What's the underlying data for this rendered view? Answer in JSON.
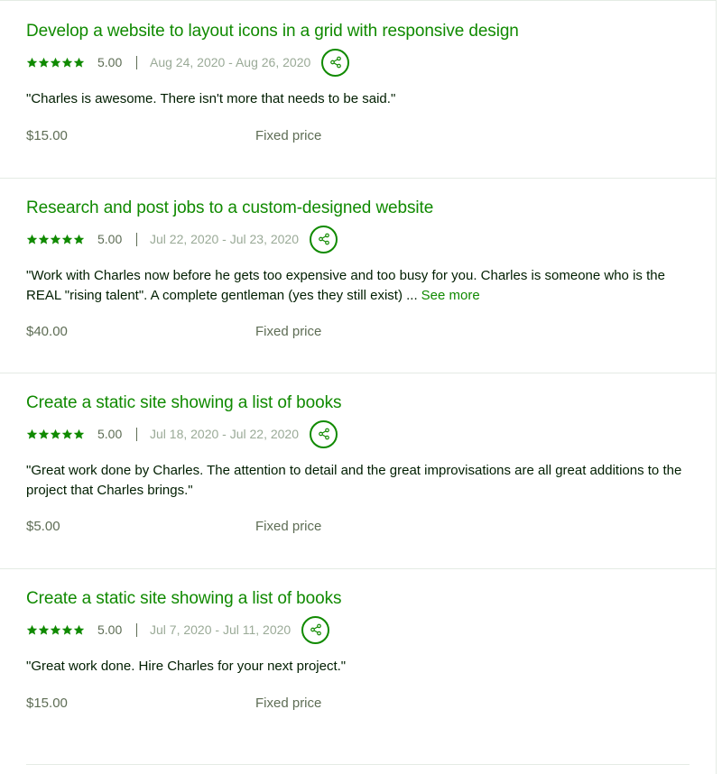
{
  "colors": {
    "accent": "#108a00",
    "text": "#001e00",
    "muted": "#5e6d55",
    "date": "#9aaa97",
    "divider": "#e4ebe4"
  },
  "icons": {
    "star": "star-icon",
    "share": "share-icon"
  },
  "jobs": [
    {
      "title": "Develop a website to layout icons in a grid with responsive design",
      "score": "5.00",
      "dates": "Aug 24, 2020 - Aug 26, 2020",
      "quote": "\"Charles is awesome. There isn't more that needs to be said.\"",
      "price": "$15.00",
      "price_type": "Fixed price"
    },
    {
      "title": "Research and post jobs to a custom-designed website",
      "score": "5.00",
      "dates": "Jul 22, 2020 - Jul 23, 2020",
      "quote": "\"Work with Charles now before he gets too expensive and too busy for you. Charles is someone who is the REAL \"rising talent\". A complete gentleman (yes they still exist) ...",
      "see_more": "See more",
      "price": "$40.00",
      "price_type": "Fixed price"
    },
    {
      "title": "Create a static site showing a list of books",
      "score": "5.00",
      "dates": "Jul 18, 2020 - Jul 22, 2020",
      "quote": "\"Great work done by Charles. The attention to detail and the great improvisations are all great additions to the project that Charles brings.\"",
      "price": "$5.00",
      "price_type": "Fixed price"
    },
    {
      "title": "Create a static site showing a list of books",
      "score": "5.00",
      "dates": "Jul 7, 2020 - Jul 11, 2020",
      "quote": "\"Great work done. Hire Charles for your next project.\"",
      "price": "$15.00",
      "price_type": "Fixed price"
    }
  ]
}
